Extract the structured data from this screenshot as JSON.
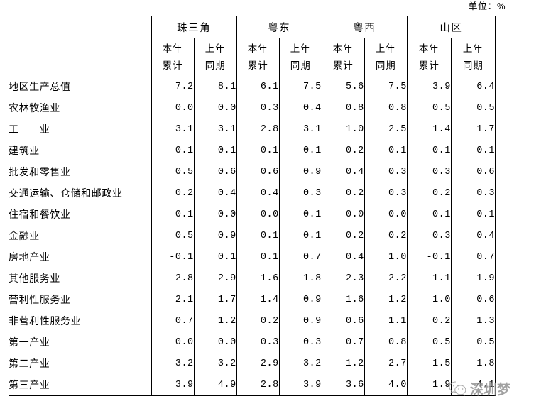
{
  "unit_note": "单位：%",
  "table": {
    "corner_label": "",
    "column_groups": [
      {
        "name": "珠三角"
      },
      {
        "name": "粤东"
      },
      {
        "name": "粤西"
      },
      {
        "name": "山区"
      }
    ],
    "sub_headers": [
      {
        "line1": "本年",
        "line2": "累计"
      },
      {
        "line1": "上年",
        "line2": "同期"
      },
      {
        "line1": "本年",
        "line2": "累计"
      },
      {
        "line1": "上年",
        "line2": "同期"
      },
      {
        "line1": "本年",
        "line2": "累计"
      },
      {
        "line1": "上年",
        "line2": "同期"
      },
      {
        "line1": "本年",
        "line2": "累计"
      },
      {
        "line1": "上年",
        "line2": "同期"
      }
    ],
    "rows": [
      {
        "label": "地区生产总值",
        "indent": 0,
        "values": [
          "7.2",
          "8.1",
          "6.1",
          "7.5",
          "5.6",
          "7.5",
          "3.9",
          "6.4"
        ]
      },
      {
        "label": "农林牧渔业",
        "indent": 1,
        "values": [
          "0.0",
          "0.0",
          "0.3",
          "0.4",
          "0.8",
          "0.8",
          "0.5",
          "0.5"
        ]
      },
      {
        "label": "工　　业",
        "indent": 1,
        "values": [
          "3.1",
          "3.1",
          "2.8",
          "3.1",
          "1.0",
          "2.5",
          "1.4",
          "1.7"
        ]
      },
      {
        "label": "建筑业",
        "indent": 1,
        "values": [
          "0.1",
          "0.1",
          "0.1",
          "0.1",
          "0.2",
          "0.1",
          "0.1",
          "0.1"
        ]
      },
      {
        "label": "批发和零售业",
        "indent": 1,
        "values": [
          "0.5",
          "0.6",
          "0.6",
          "0.9",
          "0.4",
          "0.3",
          "0.3",
          "0.6"
        ]
      },
      {
        "label": "交通运输、仓储和邮政业",
        "indent": 1,
        "values": [
          "0.2",
          "0.4",
          "0.4",
          "0.3",
          "0.2",
          "0.3",
          "0.2",
          "0.3"
        ]
      },
      {
        "label": "住宿和餐饮业",
        "indent": 1,
        "values": [
          "0.1",
          "0.0",
          "0.0",
          "0.1",
          "0.0",
          "0.0",
          "0.1",
          "0.1"
        ]
      },
      {
        "label": "金融业",
        "indent": 1,
        "values": [
          "0.5",
          "0.9",
          "0.1",
          "0.1",
          "0.2",
          "0.2",
          "0.3",
          "0.4"
        ]
      },
      {
        "label": "房地产业",
        "indent": 1,
        "values": [
          "-0.1",
          "0.1",
          "0.1",
          "0.7",
          "0.4",
          "1.0",
          "-0.1",
          "0.7"
        ]
      },
      {
        "label": "其他服务业",
        "indent": 1,
        "values": [
          "2.8",
          "2.9",
          "1.6",
          "1.8",
          "2.3",
          "2.2",
          "1.1",
          "1.9"
        ]
      },
      {
        "label": "营利性服务业",
        "indent": 2,
        "values": [
          "2.1",
          "1.7",
          "1.4",
          "0.9",
          "1.6",
          "1.2",
          "1.0",
          "0.6"
        ]
      },
      {
        "label": "非营利性服务业",
        "indent": 2,
        "values": [
          "0.7",
          "1.2",
          "0.2",
          "0.9",
          "0.6",
          "1.1",
          "0.2",
          "1.3"
        ]
      },
      {
        "label": "第一产业",
        "indent": 0,
        "values": [
          "0.0",
          "0.0",
          "0.3",
          "0.3",
          "0.7",
          "0.8",
          "0.5",
          "0.5"
        ]
      },
      {
        "label": "第二产业",
        "indent": 0,
        "values": [
          "3.2",
          "3.2",
          "2.9",
          "3.2",
          "1.2",
          "2.7",
          "1.5",
          "1.8"
        ]
      },
      {
        "label": "第三产业",
        "indent": 0,
        "values": [
          "3.9",
          "4.9",
          "2.8",
          "3.9",
          "3.6",
          "4.0",
          "1.9",
          "4.1"
        ]
      }
    ]
  },
  "watermark": {
    "text": "深圳梦",
    "icon": "wechat-logo-icon"
  }
}
